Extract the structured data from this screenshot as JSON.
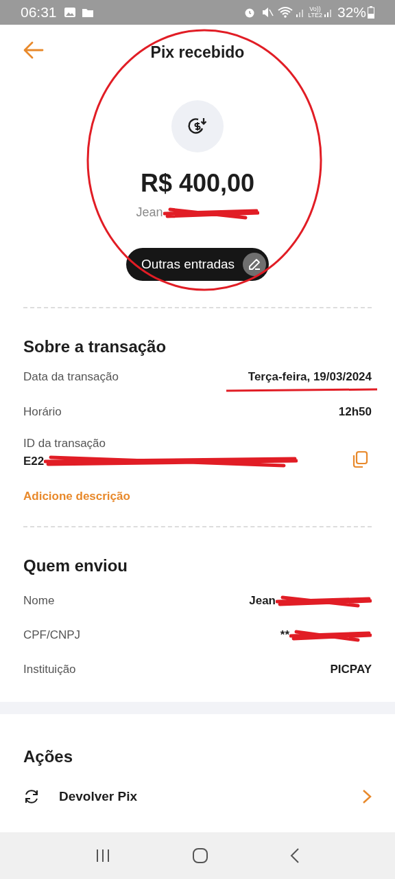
{
  "status_bar": {
    "time": "06:31",
    "battery": "32%",
    "network": "Vo))\nLTE2"
  },
  "header": {
    "title": "Pix recebido"
  },
  "summary": {
    "amount": "R$ 400,00",
    "sender_name_visible": "Jean",
    "category": "Outras entradas"
  },
  "transaction": {
    "title": "Sobre a transação",
    "rows": [
      {
        "label": "Data da transação",
        "value": "Terça-feira, 19/03/2024"
      },
      {
        "label": "Horário",
        "value": "12h50"
      }
    ],
    "id_label": "ID da transação",
    "id_visible": "E22",
    "add_description": "Adicione descrição"
  },
  "sender": {
    "title": "Quem enviou",
    "rows": [
      {
        "label": "Nome",
        "value": "Jean",
        "redacted": true
      },
      {
        "label": "CPF/CNPJ",
        "value": "**",
        "redacted": true
      },
      {
        "label": "Instituição",
        "value": "PICPAY",
        "redacted": false
      }
    ]
  },
  "actions": {
    "title": "Ações",
    "items": [
      {
        "label": "Devolver Pix"
      }
    ]
  }
}
